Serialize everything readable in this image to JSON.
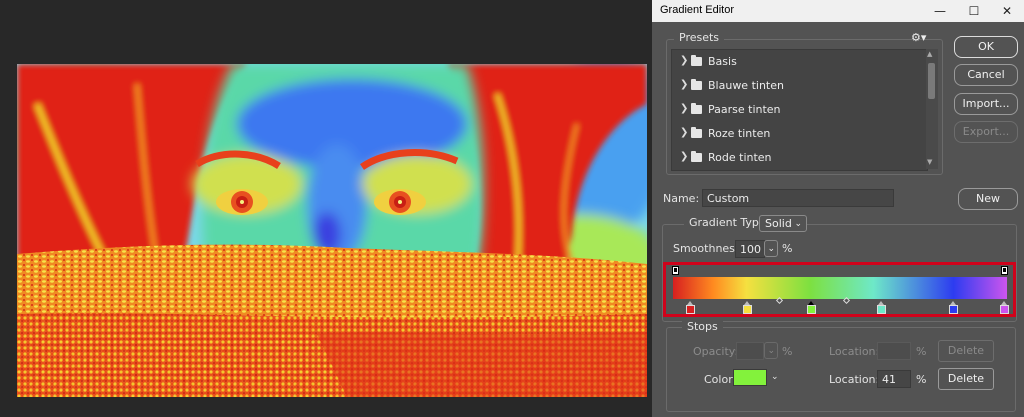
{
  "dialog": {
    "title": "Gradient Editor",
    "buttons": {
      "ok": "OK",
      "cancel": "Cancel",
      "import": "Import...",
      "export": "Export...",
      "new": "New"
    },
    "presets": {
      "label": "Presets",
      "items": [
        {
          "label": "Basis"
        },
        {
          "label": "Blauwe tinten"
        },
        {
          "label": "Paarse tinten"
        },
        {
          "label": "Roze tinten"
        },
        {
          "label": "Rode tinten"
        }
      ]
    },
    "name": {
      "label": "Name:",
      "value": "Custom"
    },
    "gradient_type": {
      "label": "Gradient Type:",
      "value": "Solid"
    },
    "smoothness": {
      "label": "Smoothness:",
      "value": "100",
      "unit": "%"
    },
    "gradient": {
      "color_stops": [
        {
          "location": 0,
          "color": "#d72020"
        },
        {
          "location": 22,
          "color": "#f5e040"
        },
        {
          "location": 41,
          "color": "#83f23c",
          "selected": true
        },
        {
          "location": 62,
          "color": "#6ee8c8"
        },
        {
          "location": 84,
          "color": "#2d3cf0"
        },
        {
          "location": 100,
          "color": "#cc55ee"
        }
      ],
      "opacity_stops": [
        {
          "location": 0
        },
        {
          "location": 100
        }
      ],
      "midpoints": [
        32,
        52
      ]
    },
    "stops": {
      "label": "Stops",
      "opacity_label": "Opacity:",
      "opacity_unit": "%",
      "opacity_location_label": "Location:",
      "opacity_location_unit": "%",
      "opacity_delete": "Delete",
      "color_label": "Color:",
      "color_value": "#83f23c",
      "color_location_label": "Location:",
      "color_location_value": "41",
      "color_location_unit": "%",
      "color_delete": "Delete"
    }
  },
  "colors": {
    "highlight_border": "#d0021b",
    "dialog_bg": "#535353",
    "workspace_bg": "#282828"
  },
  "icons": [
    "minimize-icon",
    "maximize-icon",
    "close-icon",
    "gear-icon",
    "folder-icon",
    "chevron-right-icon",
    "chevron-down-icon"
  ]
}
